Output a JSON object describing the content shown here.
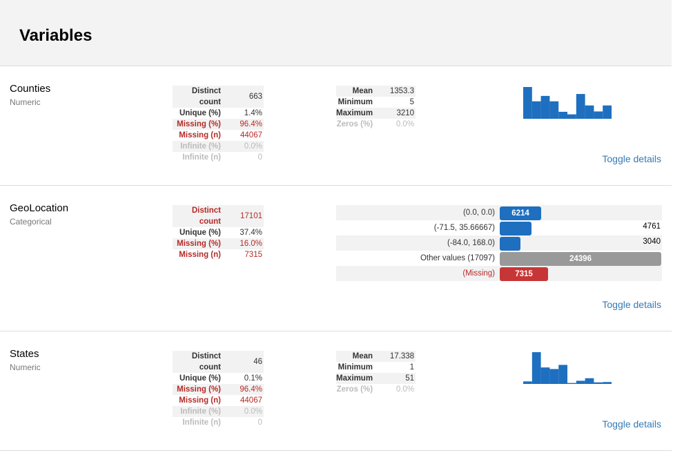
{
  "page": {
    "title": "Variables",
    "toggle_label": "Toggle details"
  },
  "counties": {
    "name": "Counties",
    "type": "Numeric",
    "stats": [
      {
        "k": "Distinct count",
        "v": "663"
      },
      {
        "k": "Unique (%)",
        "v": "1.4%"
      },
      {
        "k": "Missing (%)",
        "v": "96.4%"
      },
      {
        "k": "Missing (n)",
        "v": "44067"
      },
      {
        "k": "Infinite (%)",
        "v": "0.0%"
      },
      {
        "k": "Infinite (n)",
        "v": "0"
      }
    ],
    "summary": [
      {
        "k": "Mean",
        "v": "1353.3"
      },
      {
        "k": "Minimum",
        "v": "5"
      },
      {
        "k": "Maximum",
        "v": "3210"
      },
      {
        "k": "Zeros (%)",
        "v": "0.0%"
      }
    ],
    "hist": [
      1.0,
      0.55,
      0.72,
      0.55,
      0.22,
      0.14,
      0.78,
      0.42,
      0.23,
      0.42
    ]
  },
  "geolocation": {
    "name": "GeoLocation",
    "type": "Categorical",
    "stats": [
      {
        "k": "Distinct count",
        "v": "17101"
      },
      {
        "k": "Unique (%)",
        "v": "37.4%"
      },
      {
        "k": "Missing (%)",
        "v": "16.0%"
      },
      {
        "k": "Missing (n)",
        "v": "7315"
      }
    ],
    "freq": [
      {
        "label": "(0.0, 0.0)",
        "count": "6214"
      },
      {
        "label": "(-71.5, 35.66667)",
        "count": "4761"
      },
      {
        "label": "(-84.0, 168.0)",
        "count": "3040"
      },
      {
        "label": "Other values (17097)",
        "count": "24396"
      },
      {
        "label": "(Missing)",
        "count": "7315"
      }
    ]
  },
  "states": {
    "name": "States",
    "type": "Numeric",
    "stats": [
      {
        "k": "Distinct count",
        "v": "46"
      },
      {
        "k": "Unique (%)",
        "v": "0.1%"
      },
      {
        "k": "Missing (%)",
        "v": "96.4%"
      },
      {
        "k": "Missing (n)",
        "v": "44067"
      },
      {
        "k": "Infinite (%)",
        "v": "0.0%"
      },
      {
        "k": "Infinite (n)",
        "v": "0"
      }
    ],
    "summary": [
      {
        "k": "Mean",
        "v": "17.338"
      },
      {
        "k": "Minimum",
        "v": "1"
      },
      {
        "k": "Maximum",
        "v": "51"
      },
      {
        "k": "Zeros (%)",
        "v": "0.0%"
      }
    ],
    "hist": [
      0.08,
      1.0,
      0.52,
      0.47,
      0.6,
      0.03,
      0.1,
      0.18,
      0.05,
      0.06
    ]
  },
  "colors": {
    "bar": "#1e6fbf",
    "warning": "#b52b27",
    "link": "#337ab7"
  }
}
